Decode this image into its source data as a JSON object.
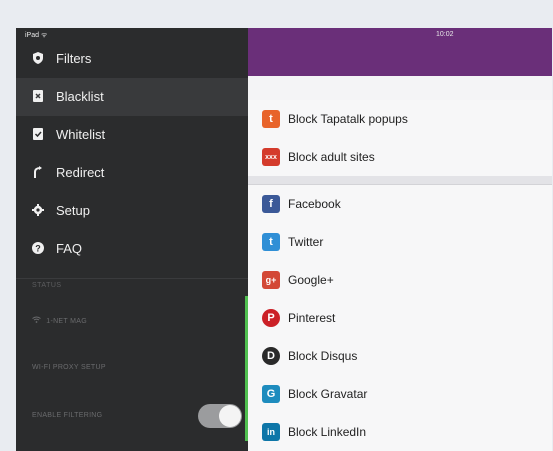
{
  "statusbar": {
    "device": "iPad ᯤ",
    "time": "10:02"
  },
  "sidebar": {
    "items": [
      {
        "label": "Filters",
        "icon": "shield-icon"
      },
      {
        "label": "Blacklist",
        "icon": "blacklist-icon"
      },
      {
        "label": "Whitelist",
        "icon": "whitelist-icon"
      },
      {
        "label": "Redirect",
        "icon": "redirect-arrow-icon"
      },
      {
        "label": "Setup",
        "icon": "gear-icon"
      },
      {
        "label": "FAQ",
        "icon": "question-icon"
      }
    ],
    "status_header": "STATUS",
    "wifi_label": "1-NET MAG",
    "proxy_label": "WI-FI PROXY SETUP",
    "filter_label": "ENABLE FILTERING",
    "filter_on": true
  },
  "main": {
    "rows": [
      {
        "label": "Block Tapatalk popups",
        "icon": "tapatalk-icon",
        "color": "#e8642b",
        "glyph": "t"
      },
      {
        "label": "Block adult sites",
        "icon": "adult-block-icon",
        "color": "#d43b2c",
        "glyph": "xxx"
      },
      {
        "label": "Facebook",
        "icon": "facebook-icon",
        "color": "#3b5998",
        "glyph": "f"
      },
      {
        "label": "Twitter",
        "icon": "twitter-icon",
        "color": "#2f8fd6",
        "glyph": "t"
      },
      {
        "label": "Google+",
        "icon": "google-plus-icon",
        "color": "#d34836",
        "glyph": "g+"
      },
      {
        "label": "Pinterest",
        "icon": "pinterest-icon",
        "color": "#cb2027",
        "glyph": "P"
      },
      {
        "label": "Block Disqus",
        "icon": "disqus-icon",
        "color": "#2a2a2a",
        "glyph": "D"
      },
      {
        "label": "Block Gravatar",
        "icon": "gravatar-icon",
        "color": "#1e8cbe",
        "glyph": "G"
      },
      {
        "label": "Block LinkedIn",
        "icon": "linkedin-icon",
        "color": "#0e76a8",
        "glyph": "in"
      }
    ],
    "accent_purple": "#6a2f79"
  }
}
